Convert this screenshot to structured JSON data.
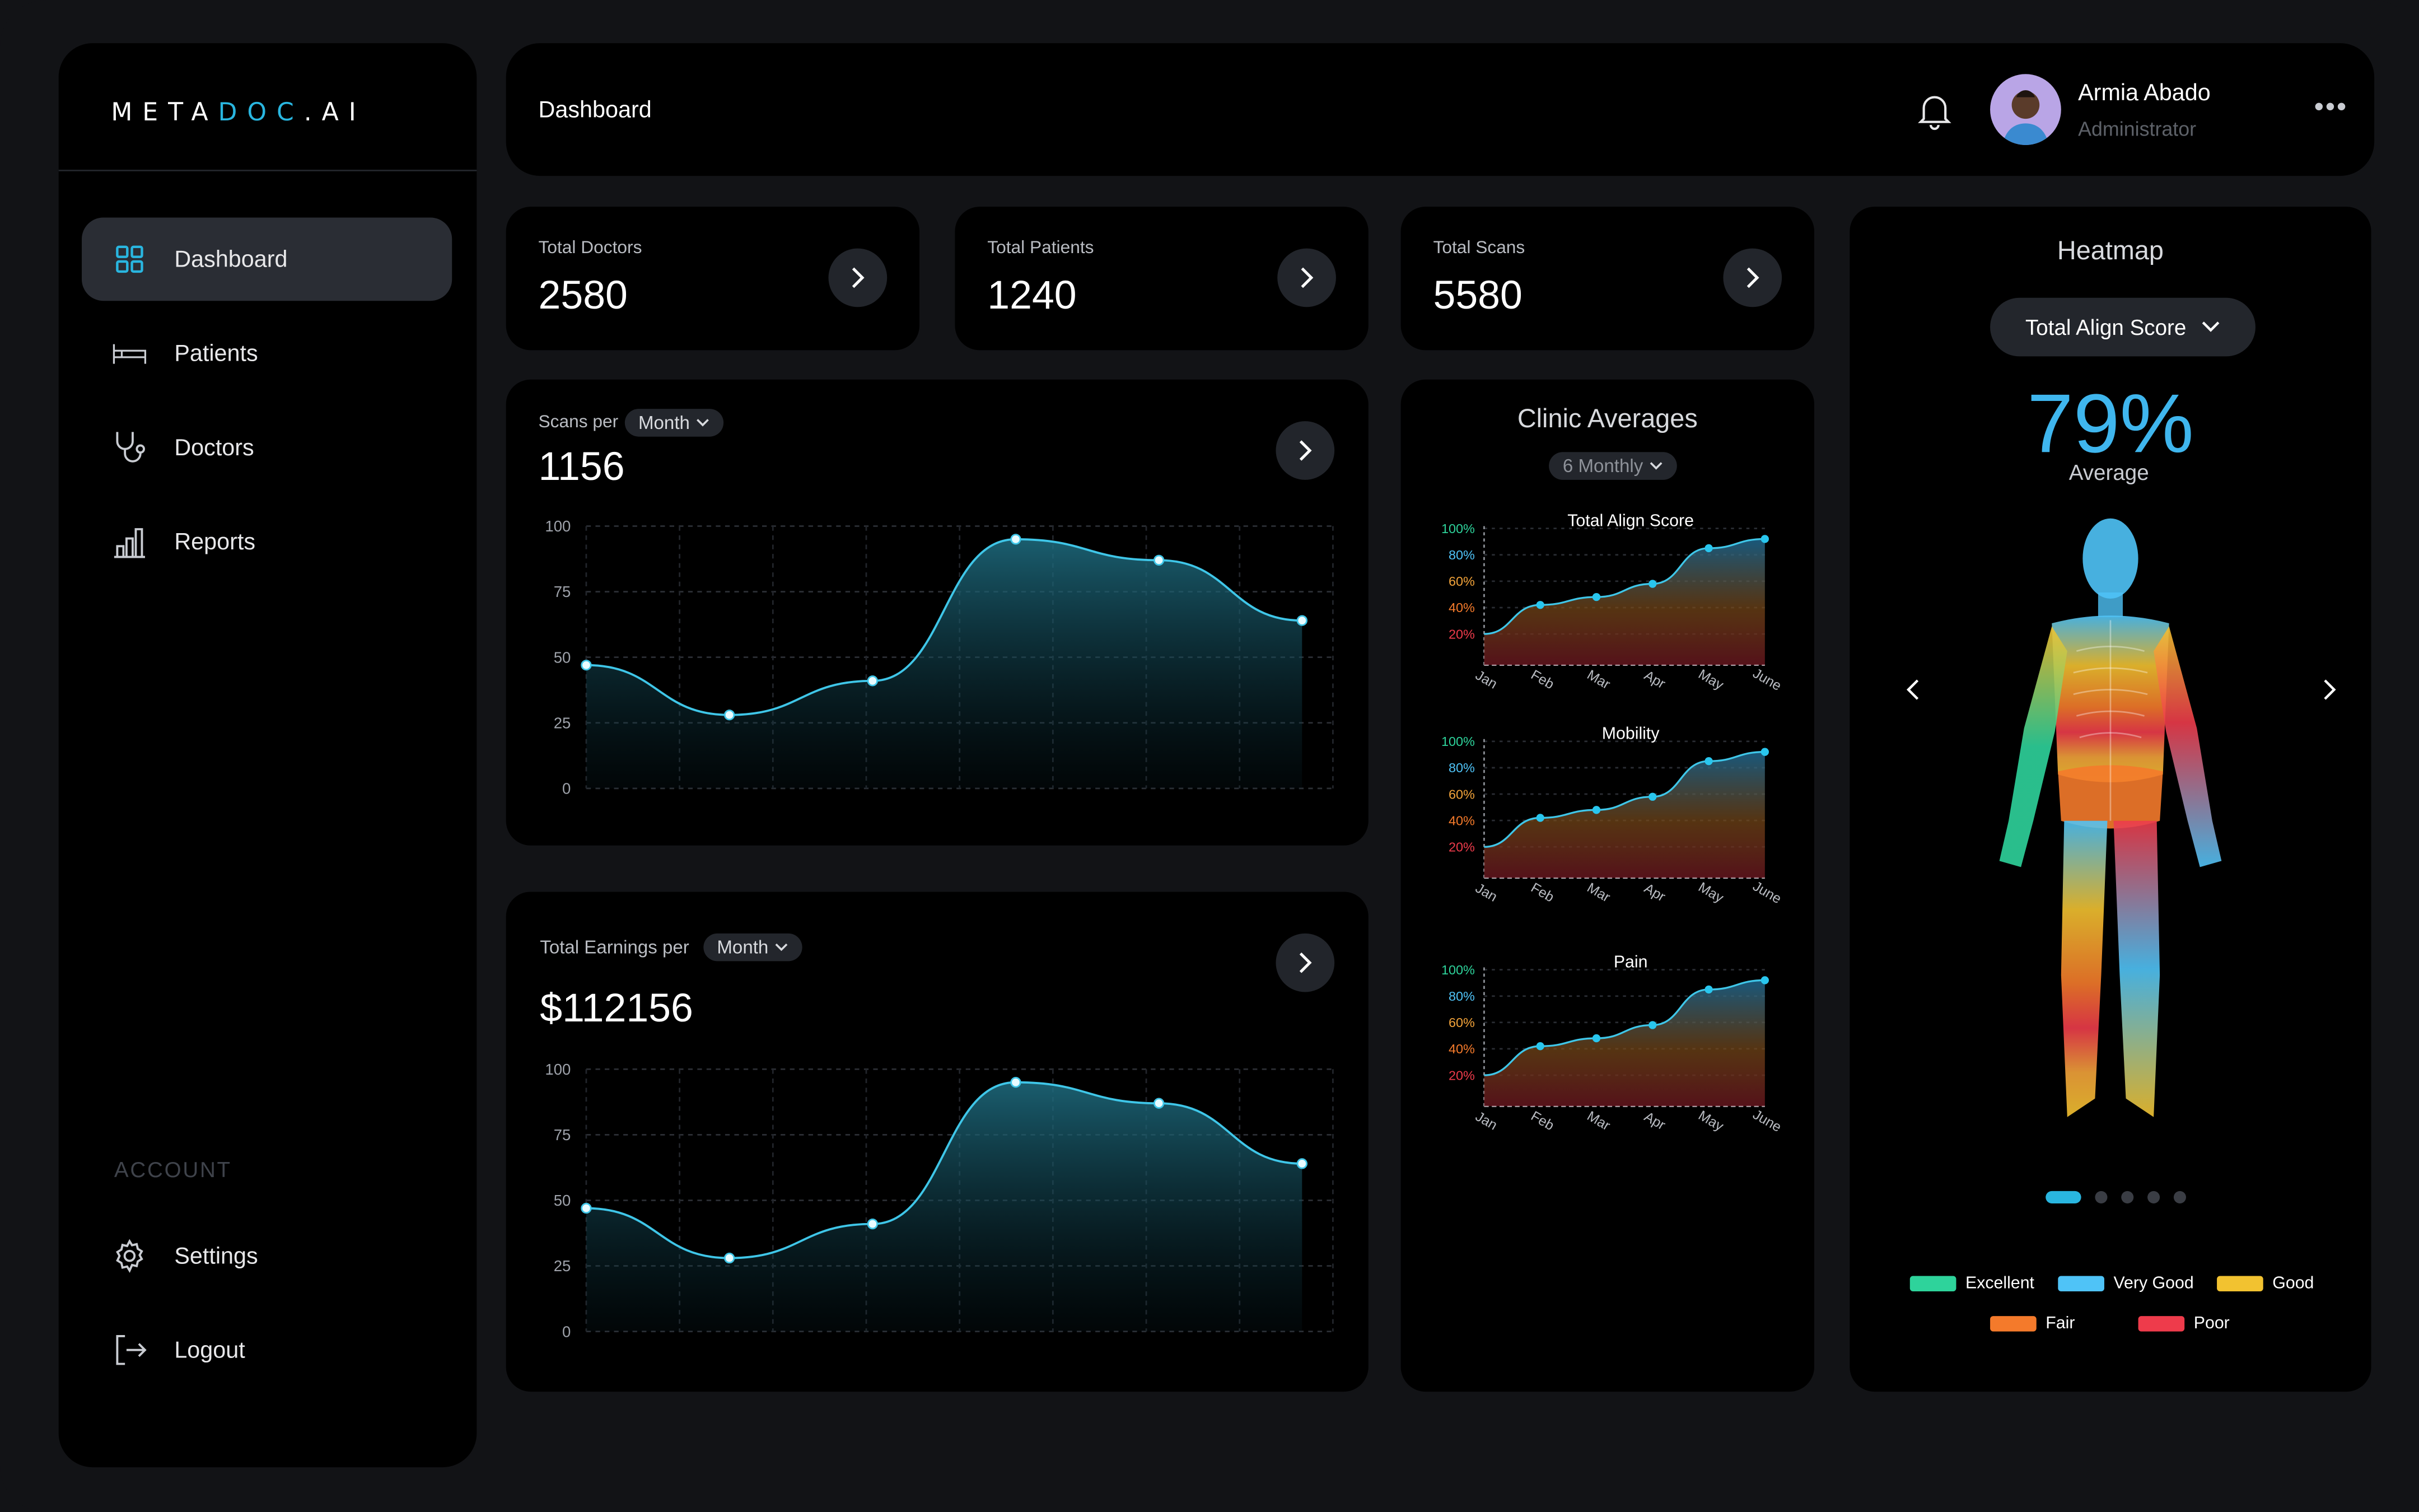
{
  "app": {
    "logo_part1": "META",
    "logo_part2": "DOC",
    "logo_part3": ".AI"
  },
  "sidebar": {
    "items": [
      {
        "label": "Dashboard",
        "icon": "grid-icon",
        "active": true
      },
      {
        "label": "Patients",
        "icon": "bed-icon"
      },
      {
        "label": "Doctors",
        "icon": "stethoscope-icon"
      },
      {
        "label": "Reports",
        "icon": "bar-chart-icon"
      }
    ],
    "account_heading": "ACCOUNT",
    "settings_label": "Settings",
    "logout_label": "Logout"
  },
  "header": {
    "title": "Dashboard",
    "user_name": "Armia Abado",
    "user_role": "Administrator"
  },
  "stats": [
    {
      "label": "Total Doctors",
      "value": "2580"
    },
    {
      "label": "Total Patients",
      "value": "1240"
    },
    {
      "label": "Total Scans",
      "value": "5580"
    }
  ],
  "scans": {
    "label": "Scans per",
    "period": "Month",
    "value": "1156"
  },
  "earnings": {
    "label": "Total Earnings per",
    "period": "Month",
    "value": "$112156"
  },
  "clinic": {
    "title": "Clinic Averages",
    "period": "6 Monthly"
  },
  "heatmap": {
    "title": "Heatmap",
    "selector": "Total Align Score",
    "percent": "79%",
    "percent_label": "Average",
    "legend": [
      {
        "label": "Excellent",
        "color": "#2ed39b"
      },
      {
        "label": "Very Good",
        "color": "#4fc3f7"
      },
      {
        "label": "Good",
        "color": "#f2c230"
      },
      {
        "label": "Fair",
        "color": "#f47a2b"
      },
      {
        "label": "Poor",
        "color": "#ee3b4b"
      }
    ]
  },
  "chart_data": [
    {
      "type": "area",
      "title": "Scans per Month",
      "x": [
        1,
        2,
        3,
        4,
        5,
        6
      ],
      "values": [
        47,
        28,
        41,
        95,
        87,
        64
      ],
      "ylim": [
        0,
        100
      ],
      "yticks": [
        "100",
        "75",
        "50",
        "25",
        "0"
      ]
    },
    {
      "type": "area",
      "title": "Total Earnings per Month",
      "x": [
        1,
        2,
        3,
        4,
        5,
        6
      ],
      "values": [
        47,
        28,
        41,
        95,
        87,
        64
      ],
      "ylim": [
        0,
        100
      ],
      "yticks": [
        "100",
        "75",
        "50",
        "25",
        "0"
      ]
    },
    {
      "type": "area",
      "title": "Total Align Score",
      "categories": [
        "Jan",
        "Feb",
        "Mar",
        "Apr",
        "May",
        "June"
      ],
      "values": [
        20,
        42,
        48,
        58,
        85,
        92
      ],
      "ylim": [
        0,
        100
      ],
      "yticks": [
        "100%",
        "80%",
        "60%",
        "40%",
        "20%"
      ]
    },
    {
      "type": "area",
      "title": "Mobility",
      "categories": [
        "Jan",
        "Feb",
        "Mar",
        "Apr",
        "May",
        "June"
      ],
      "values": [
        20,
        42,
        48,
        58,
        85,
        92
      ],
      "ylim": [
        0,
        100
      ],
      "yticks": [
        "100%",
        "80%",
        "60%",
        "40%",
        "20%"
      ]
    },
    {
      "type": "area",
      "title": "Pain",
      "categories": [
        "Jan",
        "Feb",
        "Mar",
        "Apr",
        "May",
        "June"
      ],
      "values": [
        20,
        42,
        48,
        58,
        85,
        92
      ],
      "ylim": [
        0,
        100
      ],
      "yticks": [
        "100%",
        "80%",
        "60%",
        "40%",
        "20%"
      ]
    }
  ]
}
